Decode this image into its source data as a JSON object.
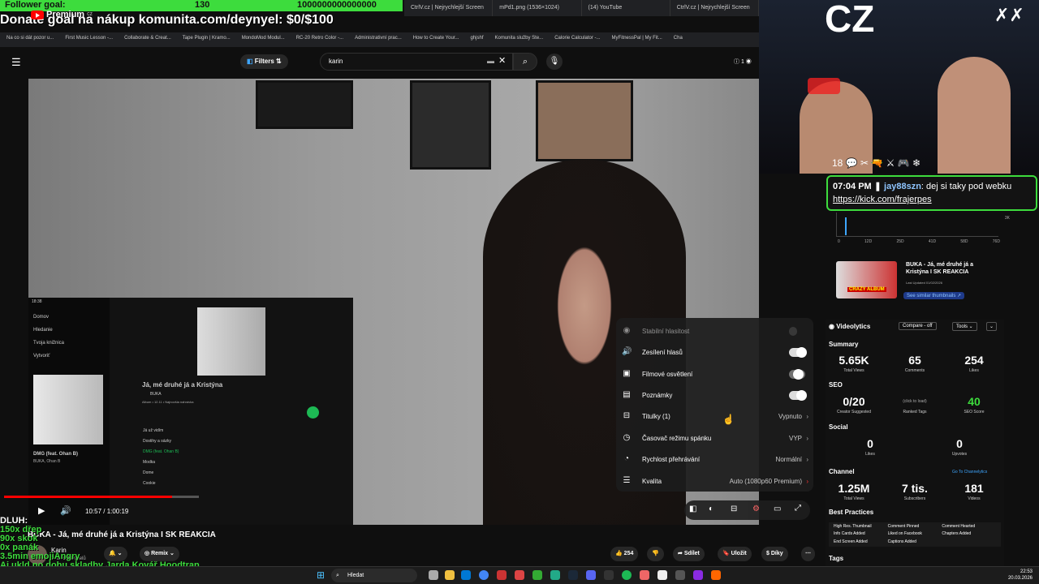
{
  "overlay": {
    "follower_goal_label": "Follower goal:",
    "follower_goal_current": "130",
    "follower_goal_target": "1000000000000000",
    "follower_goal_progress": 0.53,
    "donate_text": "Donate goal na nákup komunita.com/deynyel: $0/$100",
    "webcam_text": "CZ",
    "dluh_lines": [
      "DLUH:",
      "150x dřep",
      "90x skok",
      "0x panák",
      "3.5min emojiAngry",
      "Aj ukld po dobu skladby Jarda Kovář Hoodtrap"
    ],
    "badges": "18 💬 ✂ 🔫 ⚔ 🎮 ❄"
  },
  "browser": {
    "tabs": [
      "CtrlV.cz | Nejrychlejší Screen",
      "mPd1.png (1536×1024)",
      "(14) YouTube",
      "CtrlV.cz | Nejrychlejší Screen"
    ],
    "bookmarks": [
      "Na co si dát pozor u...",
      "First Music Lesson -...",
      "Collaborate & Creat...",
      "Tape Plugin | Kramo...",
      "MondoMod Modul...",
      "RC-20 Retro Color -...",
      "Administrativní prac...",
      "How to Create Your...",
      "ghjshf",
      "Komunita služby Ste...",
      "Calorie Calculator -...",
      "MyFitnessPal | My Fit...",
      "Cha"
    ]
  },
  "youtube": {
    "logo": "Premium",
    "logo_region": "CZ",
    "filters_label": "Filters",
    "search_value": "karin",
    "video": {
      "current_time": "10:57",
      "duration": "1:00:19",
      "time_display": "10:57 / 1:00:19",
      "progress_fraction": 0.18,
      "title": "BUKA - Já, mé druhé já a Kristýna I SK REAKCIA",
      "channel": "Karin",
      "subscribers": "7 tis. odběratelů"
    },
    "actions": {
      "remix": "Remix",
      "likes": "254",
      "share": "Sdílet",
      "save": "Uložit",
      "thanks": "Díky"
    },
    "settings": [
      {
        "label": "Stabilní hlasitost",
        "type": "toggle",
        "state": "disabled"
      },
      {
        "label": "Zesílení hlasů",
        "type": "toggle",
        "state": "on"
      },
      {
        "label": "Filmové osvětlení",
        "type": "toggle",
        "state": "off"
      },
      {
        "label": "Poznámky",
        "type": "toggle",
        "state": "on"
      },
      {
        "label": "Titulky (1)",
        "type": "menu",
        "value": "Vypnuto"
      },
      {
        "label": "Časovač režimu spánku",
        "type": "menu",
        "value": "VYP"
      },
      {
        "label": "Rychlost přehrávání",
        "type": "menu",
        "value": "Normální"
      },
      {
        "label": "Kvalita",
        "type": "menu",
        "value": "Auto (1080p60 Premium)"
      }
    ]
  },
  "phone": {
    "time": "18:38",
    "date": "st 21.12",
    "nav": [
      "Domov",
      "Hledanie",
      "Tvoja knižnica",
      "Vytvoriť"
    ],
    "song_title": "Já, mé druhé já a Kristýna",
    "artist": "BUKA",
    "album_line": "Album • 12.11 • Najnovšia nahrávka",
    "now_playing": "DMG (feat. Ohan B)",
    "now_playing_artist": "BUKA, Ohan B",
    "tracks": [
      "Já už vidím",
      "Dostihy a sázky",
      "DMG (feat. Ohan B)",
      "Modka",
      "Dome",
      "Cookie"
    ]
  },
  "chat": {
    "time": "07:04 PM",
    "user": "jay88szn",
    "message": "dej si taky pod webku",
    "link": "https://kick.com/frajerpes"
  },
  "sidebar": {
    "chart_ticks": [
      "0",
      "12D",
      "25D",
      "41D",
      "58D",
      "76D"
    ],
    "chart_y": "3K",
    "thumb_title": "BUKA - Já, mé druhé já a Kristýna I SK REAKCIA",
    "thumb_date": "Last Updated 01/02/2026",
    "thumb_badge": "CRAZY ALBUM",
    "similar_btn": "See similar thumbnails ↗",
    "videolytics": "Videolytics",
    "compare_btn": "Compare - off",
    "tools_btn": "Tools",
    "summary_label": "Summary",
    "total_views": "5.65K",
    "total_views_lbl": "Total Views",
    "comments": "65",
    "comments_lbl": "Comments",
    "likes": "254",
    "likes_lbl": "Likes",
    "seo_label": "SEO",
    "creator_suggested": "0/20",
    "creator_suggested_lbl": "Creator Suggested",
    "ranked_tags_hint": "(click to load)",
    "ranked_tags_lbl": "Ranked Tags",
    "seo_score": "40",
    "seo_score_lbl": "SEO Score",
    "social_label": "Social",
    "social_likes": "0",
    "social_likes_lbl": "Likes",
    "upvotes": "0",
    "upvotes_lbl": "Upvotes",
    "channel_label": "Channel",
    "channel_link": "Go To Channelytics",
    "ch_views": "1.25M",
    "ch_views_lbl": "Total Views",
    "ch_subs": "7 tis.",
    "ch_subs_lbl": "Subscribers",
    "ch_videos": "181",
    "ch_videos_lbl": "Videos",
    "bp_label": "Best Practices",
    "bp_items": [
      "High Res. Thumbnail",
      "Comment Pinned",
      "Comment Hearted",
      "Info Cards Added",
      "Liked on Facebook",
      "Chapters Added",
      "End Screen Added",
      "Captions Added"
    ],
    "tags_label": "Tags"
  },
  "taskbar": {
    "search": "Hledat",
    "time": "22:53",
    "date": "20.03.2026"
  },
  "colors": {
    "accent_green": "#3ddc3d",
    "yt_red": "#ff0000",
    "spotify_green": "#1db954",
    "link_blue": "#3ea6ff"
  }
}
